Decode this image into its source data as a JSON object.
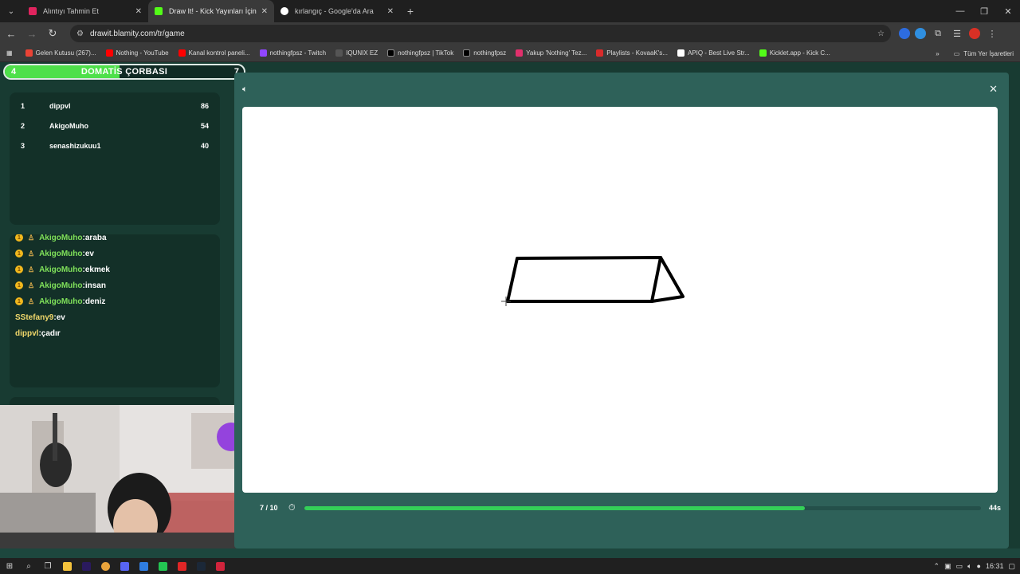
{
  "browser": {
    "tabs": [
      {
        "title": "Alıntıyı Tahmin Et",
        "color": "#e0245e",
        "active": false
      },
      {
        "title": "Draw It! - Kick Yayınları İçin Çizi",
        "color": "#53fc18",
        "active": true
      },
      {
        "title": "kırlangıç - Google'da Ara",
        "color": "#4285f4",
        "active": false
      }
    ],
    "url": "drawit.blamity.com/tr/game",
    "bookmarks": [
      {
        "label": "Gelen Kutusu (267)...",
        "color": "#ea4335"
      },
      {
        "label": "Nothing - YouTube",
        "color": "#ff0000"
      },
      {
        "label": "Kanal kontrol paneli...",
        "color": "#ff0000"
      },
      {
        "label": "nothingfpsz - Twitch",
        "color": "#9146ff"
      },
      {
        "label": "IQUNIX EZ",
        "color": "#555555"
      },
      {
        "label": "nothingfpsz | TikTok",
        "color": "#000000"
      },
      {
        "label": "nothingfpsz",
        "color": "#000000"
      },
      {
        "label": "Yakup 'Nothing' Tez...",
        "color": "#e1306c"
      },
      {
        "label": "Playlists - KovaaK's...",
        "color": "#d92b2b"
      },
      {
        "label": "APIQ - Best Live Str...",
        "color": "#ffffff"
      },
      {
        "label": "Kicklet.app - Kick C...",
        "color": "#53fc18"
      }
    ],
    "bookmarks_all": "Tüm Yer İşaretleri"
  },
  "game": {
    "word_bar": {
      "left": "4",
      "word": "DOMATİS ÇORBASI",
      "right": "7",
      "fill_fraction": 0.48
    },
    "leaderboard": [
      {
        "rank": "1",
        "name": "dippvl",
        "score": "86"
      },
      {
        "rank": "2",
        "name": "AkigoMuho",
        "score": "54"
      },
      {
        "rank": "3",
        "name": "senashizukuu1",
        "score": "40"
      }
    ],
    "chat": [
      {
        "user": "AkigoMuho",
        "text": "araba",
        "badge": true,
        "color": "green"
      },
      {
        "user": "AkigoMuho",
        "text": "ev",
        "badge": true,
        "color": "green"
      },
      {
        "user": "AkigoMuho",
        "text": "ekmek",
        "badge": true,
        "color": "green"
      },
      {
        "user": "AkigoMuho",
        "text": "insan",
        "badge": true,
        "color": "green"
      },
      {
        "user": "AkigoMuho",
        "text": "deniz",
        "badge": true,
        "color": "green"
      },
      {
        "user": "SStefany9",
        "text": "ev",
        "badge": false,
        "color": "yellow"
      },
      {
        "user": "dippvl",
        "text": "çadır",
        "badge": false,
        "color": "yellow"
      }
    ],
    "round": "7 / 10",
    "time_left": "44s",
    "time_fraction": 0.74
  },
  "taskbar": {
    "time": "16:31"
  },
  "colors": {
    "accent": "#53fc18",
    "panel": "#2e6159",
    "background": "#183b32"
  }
}
